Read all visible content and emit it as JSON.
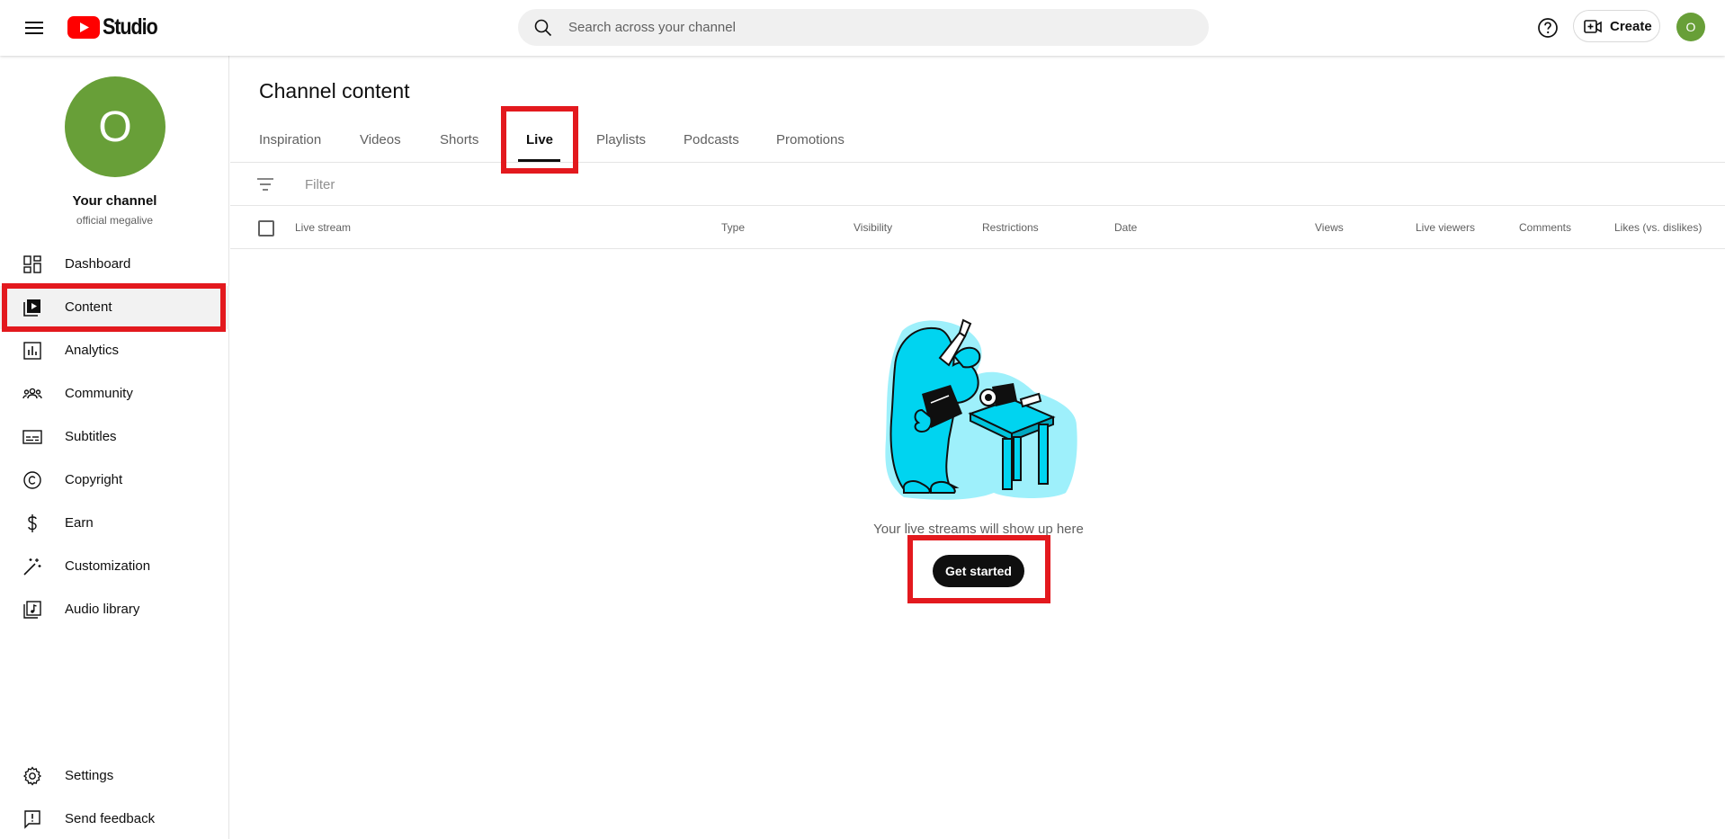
{
  "topbar": {
    "logo_text": "Studio",
    "search_placeholder": "Search across your channel",
    "create_label": "Create",
    "avatar_letter": "O"
  },
  "channel": {
    "avatar_letter": "O",
    "title": "Your channel",
    "handle": "official megalive"
  },
  "sidebar": {
    "items": [
      {
        "label": "Dashboard",
        "icon": "dashboard-icon"
      },
      {
        "label": "Content",
        "icon": "content-icon",
        "active": true
      },
      {
        "label": "Analytics",
        "icon": "analytics-icon"
      },
      {
        "label": "Community",
        "icon": "community-icon"
      },
      {
        "label": "Subtitles",
        "icon": "subtitles-icon"
      },
      {
        "label": "Copyright",
        "icon": "copyright-icon"
      },
      {
        "label": "Earn",
        "icon": "dollar-icon"
      },
      {
        "label": "Customization",
        "icon": "magic-wand-icon"
      },
      {
        "label": "Audio library",
        "icon": "audio-library-icon"
      }
    ],
    "bottom": [
      {
        "label": "Settings",
        "icon": "gear-icon"
      },
      {
        "label": "Send feedback",
        "icon": "feedback-icon"
      }
    ]
  },
  "main": {
    "title": "Channel content",
    "tabs": [
      {
        "label": "Inspiration"
      },
      {
        "label": "Videos"
      },
      {
        "label": "Shorts"
      },
      {
        "label": "Live",
        "active": true
      },
      {
        "label": "Playlists"
      },
      {
        "label": "Podcasts"
      },
      {
        "label": "Promotions"
      }
    ],
    "filter_placeholder": "Filter",
    "columns": [
      "Live stream",
      "Type",
      "Visibility",
      "Restrictions",
      "Date",
      "Views",
      "Live viewers",
      "Comments",
      "Likes (vs. dislikes)"
    ],
    "empty_message": "Your live streams will show up here",
    "get_started_label": "Get started"
  },
  "colors": {
    "brand_red": "#ff0000",
    "avatar_green": "#689f38",
    "highlight_red": "#e3191e",
    "illustration_cyan": "#00d4f0"
  }
}
